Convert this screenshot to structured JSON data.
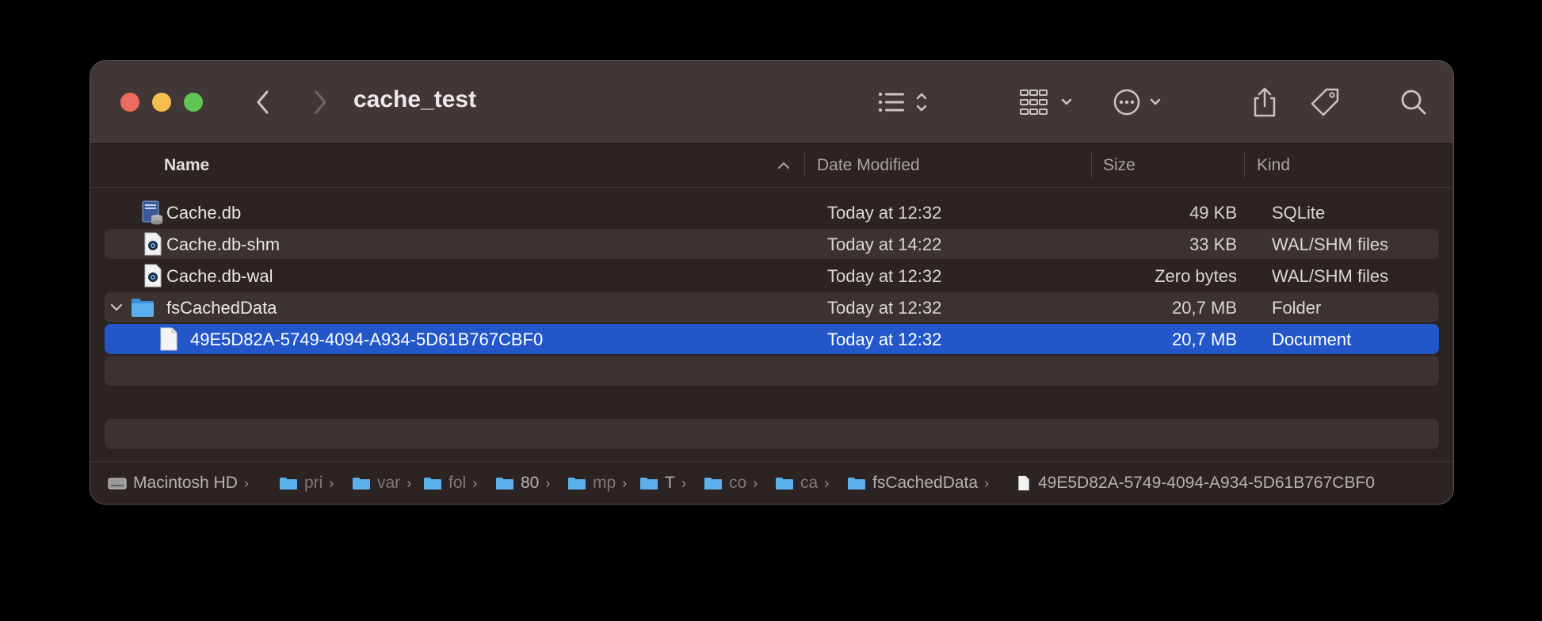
{
  "window": {
    "title": "cache_test"
  },
  "toolbar": {
    "back": "chevron-left-icon",
    "forward": "chevron-right-icon",
    "view_mode": "list-view-icon",
    "group": "grid-group-icon",
    "action": "more-ellipsis-icon",
    "share": "share-icon",
    "tags": "tag-icon",
    "search": "search-icon"
  },
  "columns": {
    "name": "Name",
    "date": "Date Modified",
    "size": "Size",
    "kind": "Kind"
  },
  "files": [
    {
      "name": "Cache.db",
      "date": "Today at 12:32",
      "size": "49 KB",
      "kind": "SQLite",
      "icon": "sqlite-db-icon"
    },
    {
      "name": "Cache.db-shm",
      "date": "Today at 14:22",
      "size": "33 KB",
      "kind": "WAL/SHM files",
      "icon": "document-eye-icon"
    },
    {
      "name": "Cache.db-wal",
      "date": "Today at 12:32",
      "size": "Zero bytes",
      "kind": "WAL/SHM files",
      "icon": "document-eye-icon"
    },
    {
      "name": "fsCachedData",
      "date": "Today at 12:32",
      "size": "20,7 MB",
      "kind": "Folder",
      "icon": "folder-icon"
    },
    {
      "name": "49E5D82A-5749-4094-A934-5D61B767CBF0",
      "date": "Today at 12:32",
      "size": "20,7 MB",
      "kind": "Document",
      "icon": "document-icon"
    }
  ],
  "pathbar": {
    "items": [
      "Macintosh HD",
      "pri",
      "var",
      "fol",
      "80",
      "mp",
      "T",
      "co",
      "ca",
      "fsCachedData",
      "49E5D82A-5749-4094-A934-5D61B767CBF0"
    ],
    "separator": "›"
  },
  "colors": {
    "selection": "#2357c9",
    "folder": "#5bb0ec",
    "close": "#ed6a5e",
    "minimize": "#f5bf4f",
    "zoom": "#61c554"
  }
}
